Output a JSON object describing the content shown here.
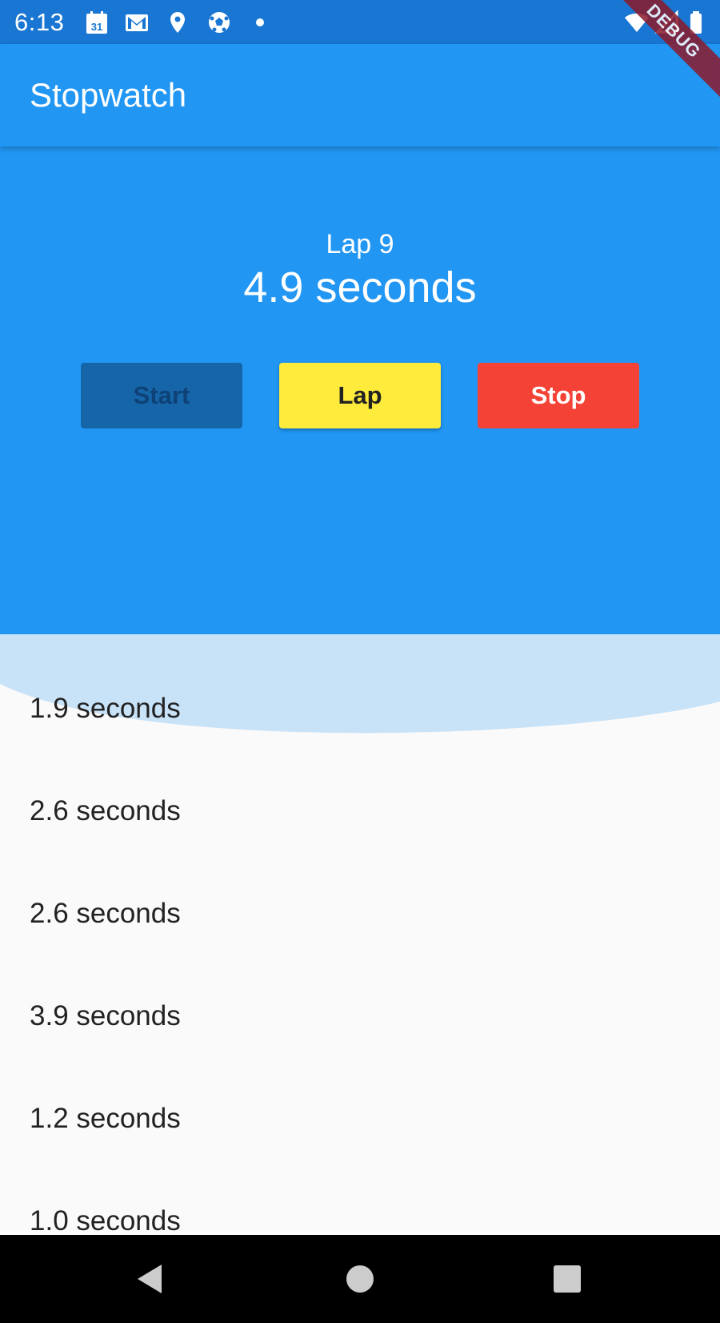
{
  "status_bar": {
    "time": "6:13",
    "left_icons": [
      "calendar-icon",
      "gmail-icon",
      "location-icon",
      "soccer-ball-icon",
      "dot-icon"
    ],
    "right_icons": [
      "wifi-icon",
      "signal-icon",
      "battery-icon"
    ],
    "calendar_day": "31"
  },
  "debug_banner": "DEBUG",
  "app_bar": {
    "title": "Stopwatch"
  },
  "timer": {
    "lap_label": "Lap 9",
    "lap_time": "4.9 seconds"
  },
  "buttons": {
    "start": "Start",
    "lap": "Lap",
    "stop": "Stop"
  },
  "laps": [
    "1.9 seconds",
    "2.6 seconds",
    "2.6 seconds",
    "3.9 seconds",
    "1.2 seconds",
    "1.0 seconds"
  ],
  "nav_bar": {
    "icons": [
      "back-icon",
      "home-icon",
      "recents-icon"
    ]
  },
  "colors": {
    "primary": "#2196f3",
    "status_bar": "#1976d2",
    "lap_button": "#ffeb3b",
    "stop_button": "#f44336",
    "start_button_disabled": "#1565a8",
    "list_highlight": "#c8e2f7"
  }
}
